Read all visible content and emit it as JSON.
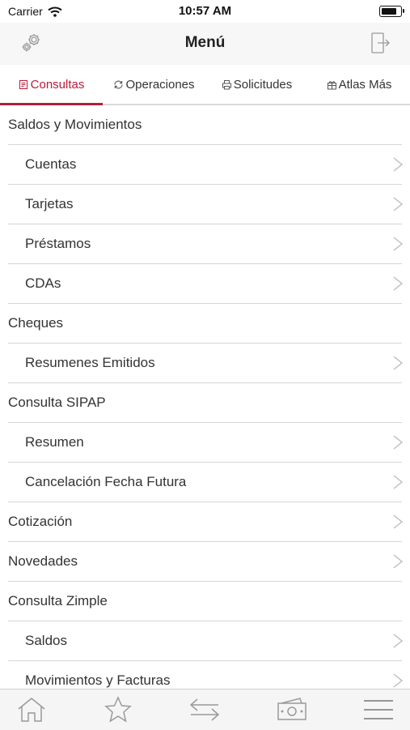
{
  "status": {
    "carrier": "Carrier",
    "time": "10:57 AM"
  },
  "navbar": {
    "title": "Menú"
  },
  "tabs": [
    {
      "label": "Consultas",
      "icon": "consultas-icon"
    },
    {
      "label": "Operaciones",
      "icon": "refresh-icon"
    },
    {
      "label": "Solicitudes",
      "icon": "printer-icon"
    },
    {
      "label": "Atlas Más",
      "icon": "gift-icon"
    }
  ],
  "menu": [
    {
      "label": "Saldos y Movimientos"
    },
    {
      "label": "Cuentas"
    },
    {
      "label": "Tarjetas"
    },
    {
      "label": "Préstamos"
    },
    {
      "label": "CDAs"
    },
    {
      "label": "Cheques"
    },
    {
      "label": "Resumenes Emitidos"
    },
    {
      "label": "Consulta SIPAP"
    },
    {
      "label": "Resumen"
    },
    {
      "label": "Cancelación Fecha Futura"
    },
    {
      "label": "Cotización"
    },
    {
      "label": "Novedades"
    },
    {
      "label": "Consulta Zimple"
    },
    {
      "label": "Saldos"
    },
    {
      "label": "Movimientos y Facturas"
    }
  ],
  "tabbar": [
    "home-icon",
    "star-icon",
    "transfer-icon",
    "money-icon",
    "menu-icon"
  ],
  "colors": {
    "accent": "#b71c3a",
    "divider": "#d6d6d6",
    "icon_gray": "#9a9a9a"
  }
}
